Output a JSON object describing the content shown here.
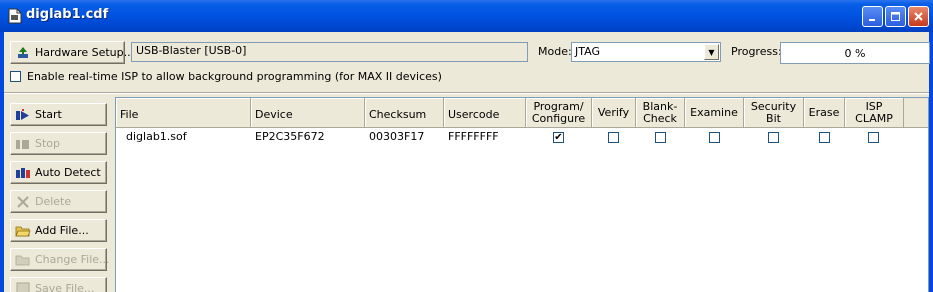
{
  "window": {
    "title": "diglab1.cdf",
    "icon": "document-icon",
    "controls": [
      "minimize",
      "maximize",
      "close"
    ]
  },
  "toolbar": {
    "hardware_setup_label": "Hardware Setup...",
    "hardware_value": "USB-Blaster [USB-0]",
    "mode_label": "Mode:",
    "mode_value": "JTAG",
    "progress_label": "Progress:",
    "progress_value": "0 %",
    "progress_fraction": 0
  },
  "isp_option": {
    "label": "Enable real-time ISP to allow background programming (for MAX II devices)",
    "checked": false
  },
  "side_buttons": [
    {
      "label": "Start",
      "icon": "start-program-icon",
      "enabled": true
    },
    {
      "label": "Stop",
      "icon": "stop-program-icon",
      "enabled": false
    },
    {
      "label": "Auto Detect",
      "icon": "auto-detect-icon",
      "enabled": true
    },
    {
      "label": "Delete",
      "icon": "delete-x-icon",
      "enabled": false
    },
    {
      "label": "Add File...",
      "icon": "folder-open-icon",
      "enabled": true
    },
    {
      "label": "Change File...",
      "icon": "change-file-icon",
      "enabled": false
    },
    {
      "label": "Save File...",
      "icon": "save-file-icon",
      "enabled": false
    }
  ],
  "table": {
    "columns": [
      "File",
      "Device",
      "Checksum",
      "Usercode",
      "Program/ Configure",
      "Verify",
      "Blank- Check",
      "Examine",
      "Security Bit",
      "Erase",
      "ISP CLAMP"
    ],
    "rows": [
      {
        "file": "diglab1.sof",
        "device": "EP2C35F672",
        "checksum": "00303F17",
        "usercode": "FFFFFFFF",
        "program_configure": true,
        "verify": false,
        "blank_check": false,
        "examine": false,
        "security_bit": false,
        "erase": false,
        "isp_clamp": false
      }
    ]
  },
  "colors": {
    "titlebar": "#0054e3",
    "face": "#ece9d8",
    "close_button": "#c6391e"
  }
}
